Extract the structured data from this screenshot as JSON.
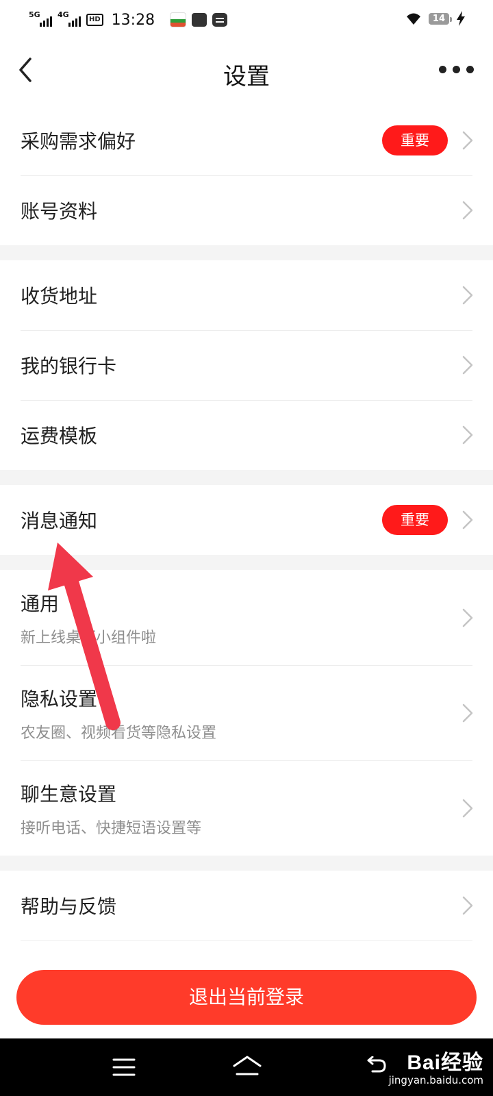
{
  "status_bar": {
    "network_1": "5G",
    "network_2": "4G",
    "hd_label": "HD",
    "time": "13:28",
    "battery_level": "14"
  },
  "header": {
    "title": "设置"
  },
  "settings": {
    "group1": [
      {
        "label": "采购需求偏好",
        "badge": "重要"
      },
      {
        "label": "账号资料"
      }
    ],
    "group2": [
      {
        "label": "收货地址"
      },
      {
        "label": "我的银行卡"
      },
      {
        "label": "运费模板"
      }
    ],
    "group3": [
      {
        "label": "消息通知",
        "badge": "重要"
      }
    ],
    "group4": [
      {
        "label": "通用",
        "subtitle": "新上线桌面小组件啦"
      },
      {
        "label": "隐私设置",
        "subtitle": "农友圈、视频看货等隐私设置"
      },
      {
        "label": "聊生意设置",
        "subtitle": "接听电话、快捷短语设置等"
      }
    ],
    "group5": [
      {
        "label": "帮助与反馈"
      }
    ]
  },
  "logout_label": "退出当前登录",
  "watermark": {
    "main": "Bai经验",
    "sub": "jingyan.baidu.com"
  },
  "colors": {
    "badge": "#ff1a1a",
    "logout": "#ff3b2a",
    "arrow": "#f0384a"
  }
}
